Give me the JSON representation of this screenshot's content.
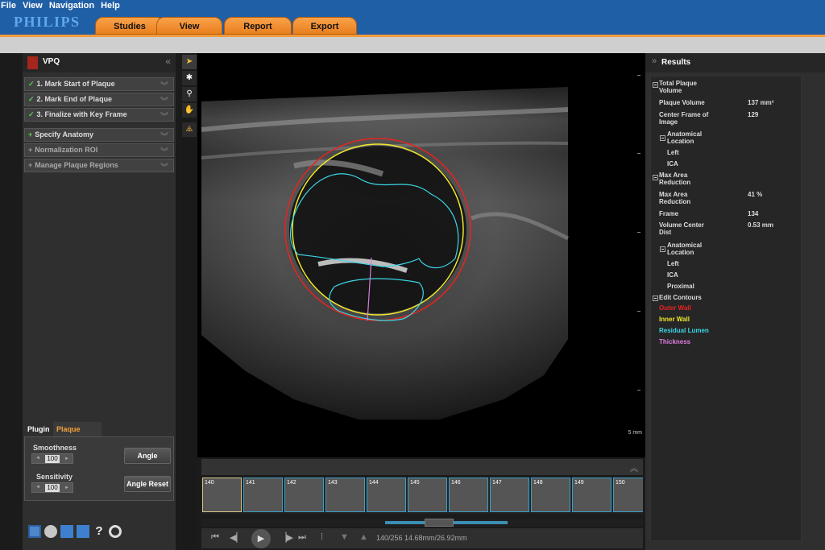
{
  "menu": [
    "File",
    "View",
    "Navigation",
    "Help"
  ],
  "brand": "PHILIPS",
  "app_tabs": [
    "Studies",
    "View",
    "Report",
    "Export"
  ],
  "left_panel": {
    "title": "VPQ",
    "steps": [
      {
        "label": "1. Mark Start of Plaque",
        "state": "done"
      },
      {
        "label": "2. Mark End of Plaque",
        "state": "done"
      },
      {
        "label": "3. Finalize with Key Frame",
        "state": "done"
      },
      {
        "label": "Specify Anatomy",
        "state": "active"
      },
      {
        "label": "Normalization ROI",
        "state": "inactive"
      },
      {
        "label": "Manage Plaque Regions",
        "state": "inactive"
      }
    ],
    "adjust_tabs": [
      "Plugin",
      "Plaque Adjust"
    ],
    "smoothness_label": "Smoothness",
    "smoothness_value": "100",
    "sensitivity_label": "Sensitivity",
    "sensitivity_value": "100",
    "angle_button": "Angle",
    "angle_reset_button": "Angle Reset",
    "bottom_icons": [
      "list-icon",
      "settings-icon",
      "save-icon",
      "exit-icon",
      "help-icon",
      "search-icon"
    ]
  },
  "tools": [
    "pointer-icon",
    "zoom-icon",
    "magnify-icon",
    "pan-icon",
    "flip-icon"
  ],
  "viewer": {
    "scale_label": "5 mm"
  },
  "filmstrip": {
    "frames": [
      "140",
      "141",
      "142",
      "143",
      "144",
      "145",
      "146",
      "147",
      "148",
      "149",
      "150"
    ],
    "current_frame": "140"
  },
  "player": {
    "status": "140/256  14.68mm/26.92mm"
  },
  "results": {
    "title": "Results",
    "total_plaque_volume": {
      "heading": "Total Plaque Volume",
      "plaque_volume_label": "Plaque Volume",
      "plaque_volume_value": "137 mm³",
      "center_frame_label": "Center Frame of Image",
      "center_frame_value": "129",
      "anatomical_location": "Anatomical Location",
      "side": "Left",
      "vessel": "ICA"
    },
    "max_area_reduction": {
      "heading": "Max Area Reduction",
      "max_area_label": "Max Area Reduction",
      "max_area_value": "41 %",
      "frame_label": "Frame",
      "frame_value": "134",
      "volume_center_label": "Volume Center Dist",
      "volume_center_value": "0.53 mm",
      "anatomical_location": "Anatomical Location",
      "side": "Left",
      "vessel": "ICA",
      "position": "Proximal"
    },
    "edit_contours": {
      "heading": "Edit Contours",
      "items": [
        {
          "label": "Outer Wall",
          "color": "#e8231f"
        },
        {
          "label": "Inner Wall",
          "color": "#f0e82a"
        },
        {
          "label": "Residual Lumen",
          "color": "#3bd6e6"
        },
        {
          "label": "Thickness",
          "color": "#e17be0"
        }
      ]
    }
  }
}
